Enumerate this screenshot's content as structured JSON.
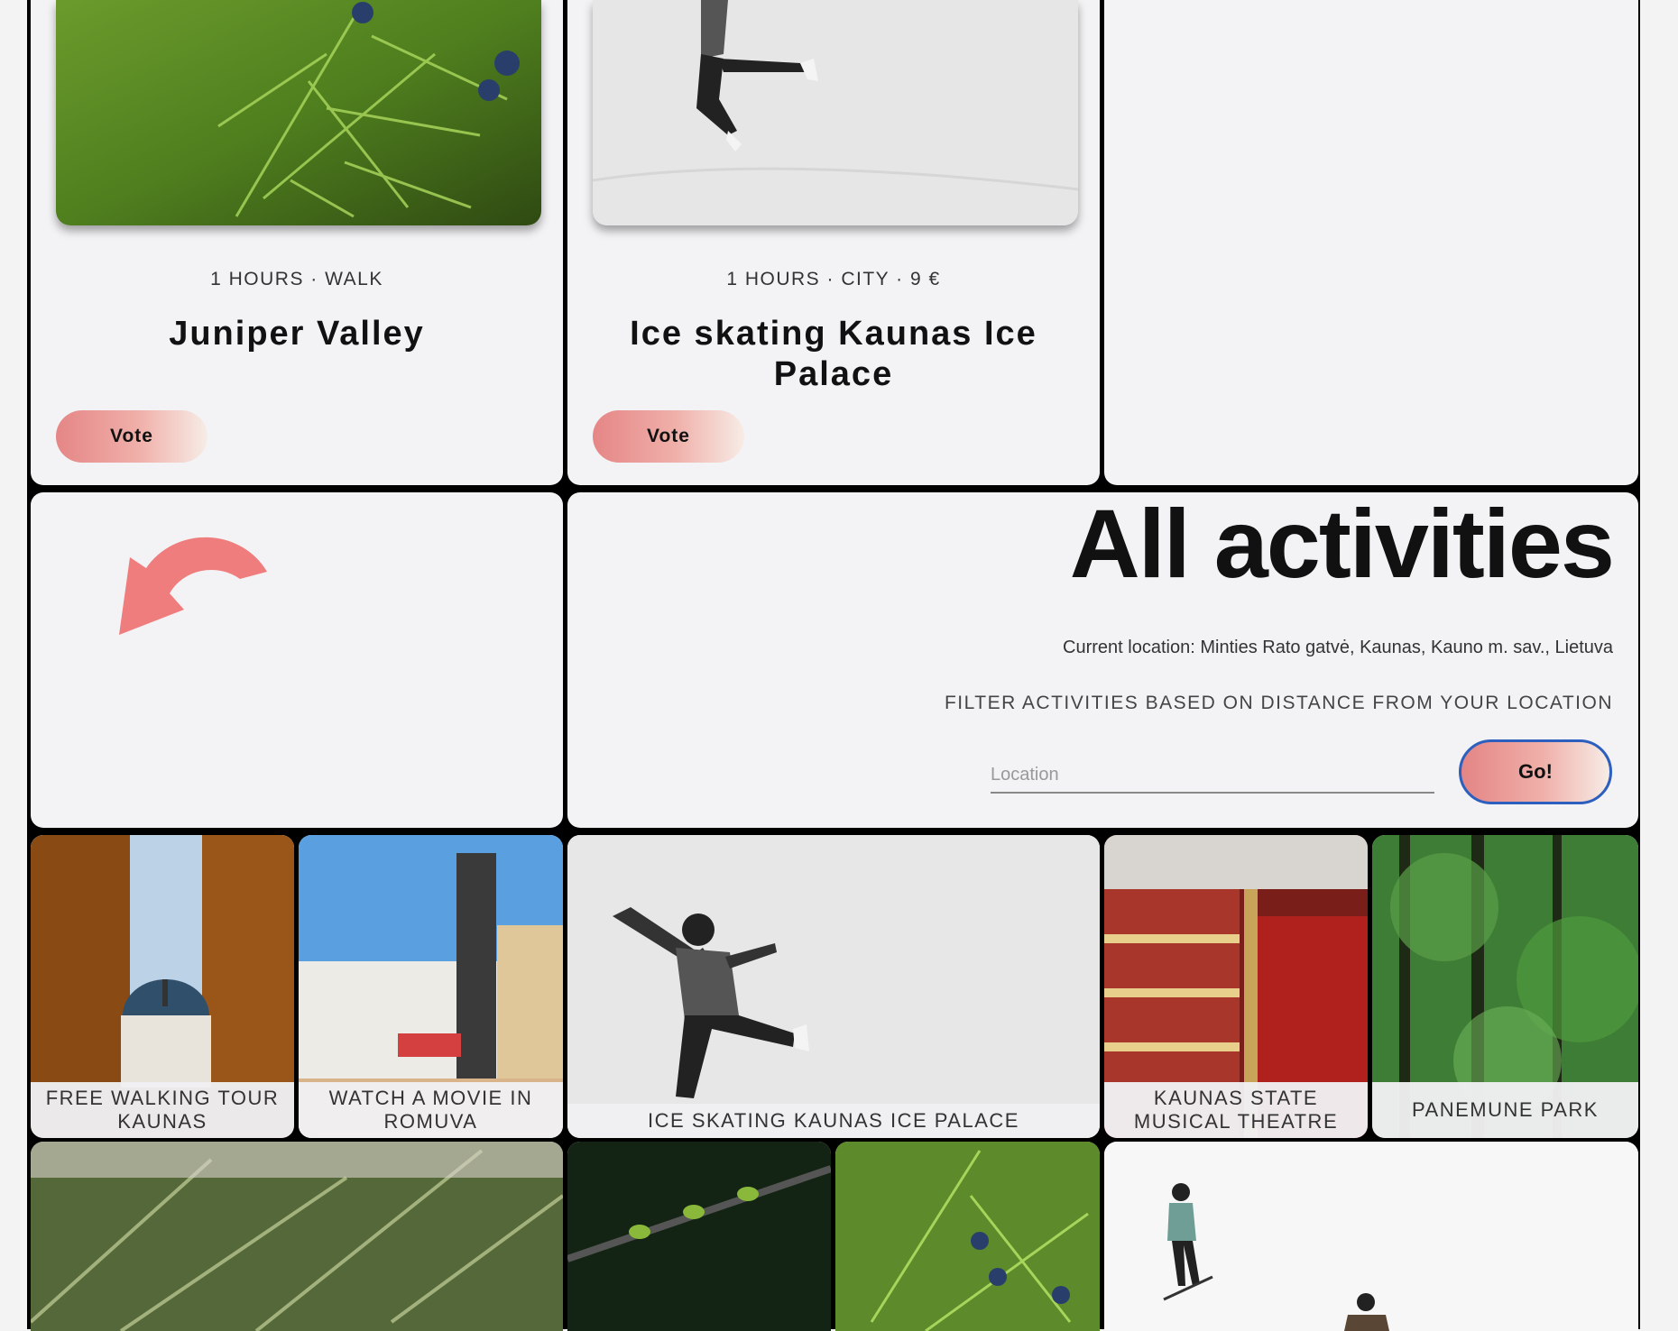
{
  "cards": [
    {
      "meta": "1 HOURS · WALK",
      "title": "Juniper Valley",
      "vote_label": "Vote"
    },
    {
      "meta": "1 HOURS · CITY · 9 €",
      "title": "Ice skating Kaunas Ice Palace",
      "vote_label": "Vote"
    }
  ],
  "main": {
    "heading": "All activities",
    "current_location": "Current location: Minties Rato gatvė, Kaunas, Kauno m. sav., Lietuva",
    "filter_label": "FILTER ACTIVITIES BASED ON DISTANCE FROM YOUR LOCATION",
    "location_placeholder": "Location",
    "go_label": "Go!"
  },
  "activities": [
    {
      "caption": "FREE WALKING TOUR KAUNAS"
    },
    {
      "caption": "WATCH A MOVIE IN ROMUVA"
    },
    {
      "caption": "ICE SKATING KAUNAS ICE PALACE"
    },
    {
      "caption": "KAUNAS STATE MUSICAL THEATRE"
    },
    {
      "caption": "PANEMUNE PARK"
    }
  ],
  "colors": {
    "accent": "#f08080",
    "button_gradient_end": "#f7ece6",
    "focus_ring": "#2d5fbe"
  }
}
